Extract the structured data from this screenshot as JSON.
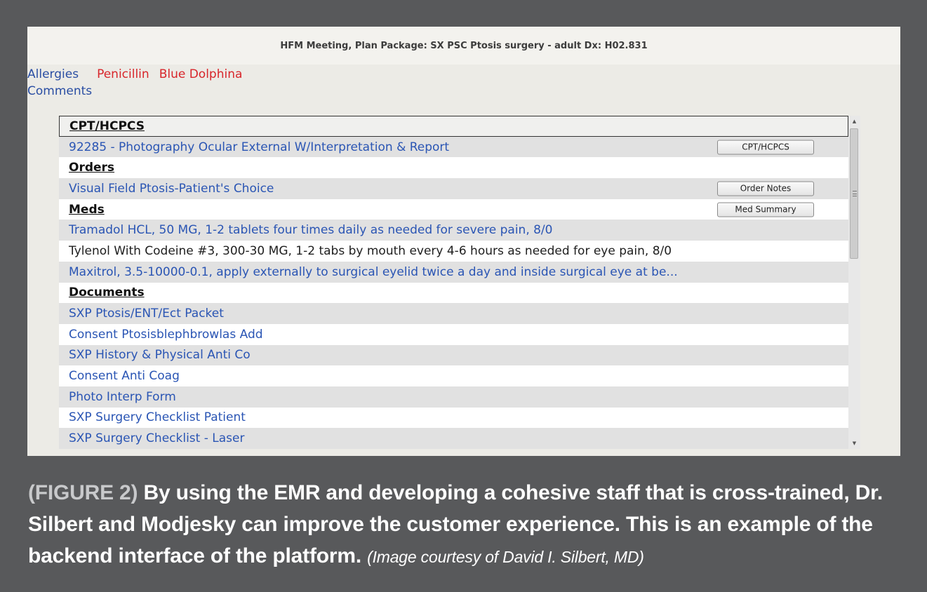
{
  "window": {
    "title": "HFM Meeting, Plan Package: SX PSC Ptosis surgery - adult Dx: H02.831"
  },
  "patient": {
    "allergies_label": "Allergies",
    "allergies": [
      "Penicillin",
      "Blue Dolphina"
    ],
    "comments_label": "Comments"
  },
  "panel": {
    "rows": [
      {
        "type": "header",
        "text": "CPT/HCPCS"
      },
      {
        "type": "item",
        "text": "92285 - Photography Ocular External W/Interpretation & Report",
        "button": "CPT/HCPCS"
      },
      {
        "type": "header",
        "text": "Orders"
      },
      {
        "type": "item",
        "text": "Visual Field Ptosis-Patient's Choice",
        "button": "Order Notes"
      },
      {
        "type": "header",
        "text": "Meds",
        "button": "Med Summary"
      },
      {
        "type": "item",
        "text": "Tramadol HCL, 50 MG, 1-2 tablets four times daily as needed for severe pain, 8/0"
      },
      {
        "type": "item",
        "text": "Tylenol With Codeine #3, 300-30 MG, 1-2 tabs by mouth every 4-6 hours as needed for eye pain, 8/0",
        "dark": true
      },
      {
        "type": "item",
        "text": "Maxitrol, 3.5-10000-0.1, apply externally to surgical eyelid twice a day and inside surgical eye at be..."
      },
      {
        "type": "header",
        "text": "Documents"
      },
      {
        "type": "item",
        "text": "SXP Ptosis/ENT/Ect Packet"
      },
      {
        "type": "item",
        "text": "Consent Ptosisblephbrowlas Add"
      },
      {
        "type": "item",
        "text": "SXP History & Physical Anti Co"
      },
      {
        "type": "item",
        "text": "Consent Anti Coag"
      },
      {
        "type": "item",
        "text": "Photo Interp Form"
      },
      {
        "type": "item",
        "text": "SXP Surgery Checklist Patient"
      },
      {
        "type": "item",
        "text": "SXP Surgery Checklist - Laser"
      }
    ]
  },
  "scrollbar": {
    "up_glyph": "▲",
    "down_glyph": "▼"
  },
  "caption": {
    "figure_label": "(FIGURE 2)",
    "text": "By using the EMR and developing a cohesive staff that is cross-trained, Dr. Silbert and Modjesky can improve the customer experience. This is an example of the backend interface of the platform.",
    "credit": "(Image courtesy of David I. Silbert, MD)"
  }
}
